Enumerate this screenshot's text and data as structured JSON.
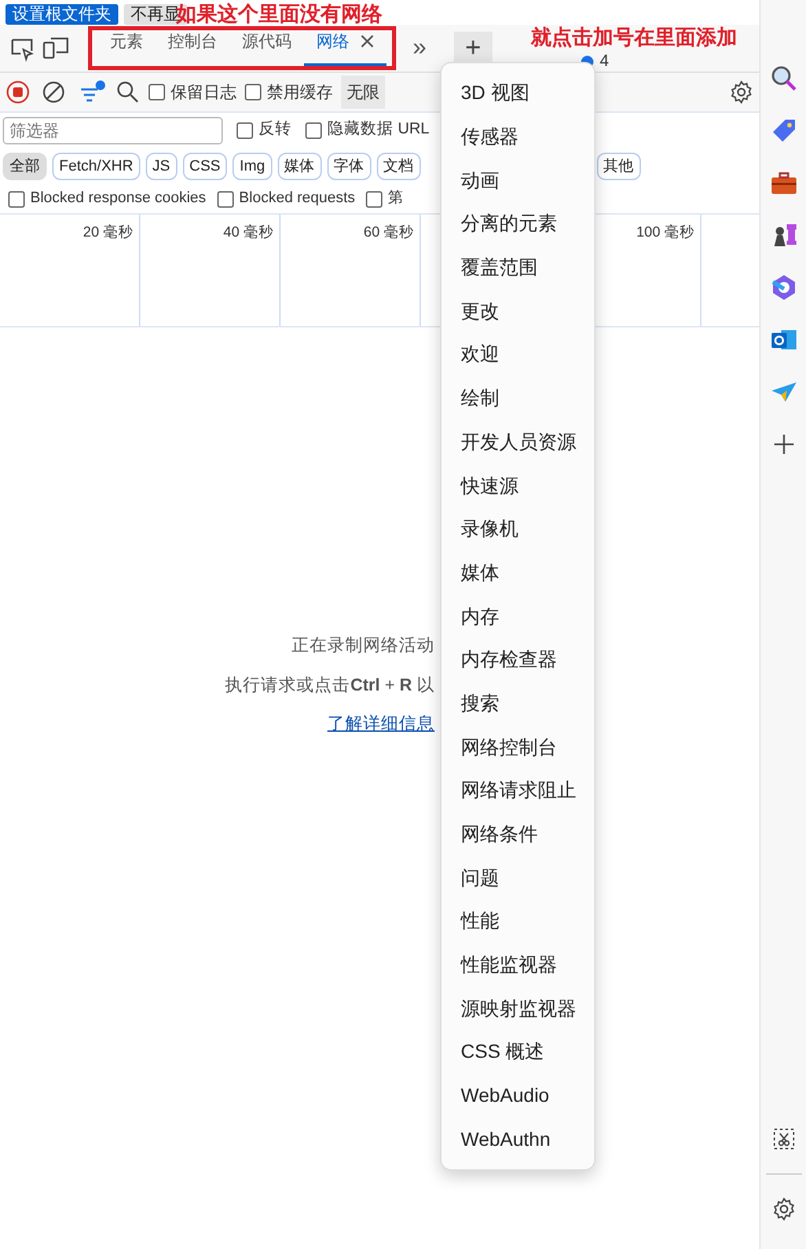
{
  "top_buttons": [
    {
      "label": "设置根文件夹",
      "kind": "primary"
    },
    {
      "label": "不再显",
      "kind": "secondary"
    }
  ],
  "annotations": [
    {
      "text": "如果这个里面没有网络",
      "kind": "above"
    },
    {
      "text": "就点击加号在里面添加",
      "kind": "right"
    }
  ],
  "tabs": [
    {
      "label": "元素",
      "selected": false,
      "closable": false
    },
    {
      "label": "控制台",
      "selected": false,
      "closable": false
    },
    {
      "label": "源代码",
      "selected": false,
      "closable": false
    },
    {
      "label": "网络",
      "selected": true,
      "closable": true
    }
  ],
  "more_tabs": "»",
  "add_tab": "+",
  "issues_count": "4",
  "toolbar": {
    "recording": true,
    "checkboxes": [
      {
        "label": "保留日志",
        "checked": false
      },
      {
        "label": "禁用缓存",
        "checked": false
      }
    ],
    "throttle": "无限"
  },
  "filter": {
    "placeholder": "筛选器",
    "checkboxes": [
      {
        "label": "反转",
        "checked": false
      },
      {
        "label": "隐藏数据 URL",
        "checked": false
      }
    ]
  },
  "type_filters": [
    {
      "label": "全部",
      "selected": true
    },
    {
      "label": "Fetch/XHR",
      "selected": false
    },
    {
      "label": "JS",
      "selected": false
    },
    {
      "label": "CSS",
      "selected": false
    },
    {
      "label": "Img",
      "selected": false
    },
    {
      "label": "媒体",
      "selected": false
    },
    {
      "label": "字体",
      "selected": false
    },
    {
      "label": "文档",
      "selected": false
    },
    {
      "label": "其他",
      "selected": false
    }
  ],
  "blocked_checkboxes": [
    {
      "label": "Blocked response cookies",
      "checked": false
    },
    {
      "label": "Blocked requests",
      "checked": false
    },
    {
      "label": "第",
      "checked": false
    }
  ],
  "timeline": {
    "columns": [
      {
        "label": "20 毫秒"
      },
      {
        "label": "40 毫秒"
      },
      {
        "label": "60 毫秒"
      },
      {},
      {
        "label": "100 毫秒"
      },
      {}
    ]
  },
  "empty_state": {
    "lines": [
      "正在录制网络活动",
      "执行请求或点击**Ctrl** + **R** 以"
    ],
    "link": "了解详细信息"
  },
  "menu": {
    "items": [
      "3D 视图",
      "传感器",
      "动画",
      "分离的元素",
      "覆盖范围",
      "更改",
      "欢迎",
      "绘制",
      "开发人员资源",
      "快速源",
      "录像机",
      "媒体",
      "内存",
      "内存检查器",
      "搜索",
      "网络控制台",
      "网络请求阻止",
      "网络条件",
      "问题",
      "性能",
      "性能监视器",
      "源映射监视器",
      "CSS 概述",
      "WebAudio",
      "WebAuthn"
    ]
  }
}
